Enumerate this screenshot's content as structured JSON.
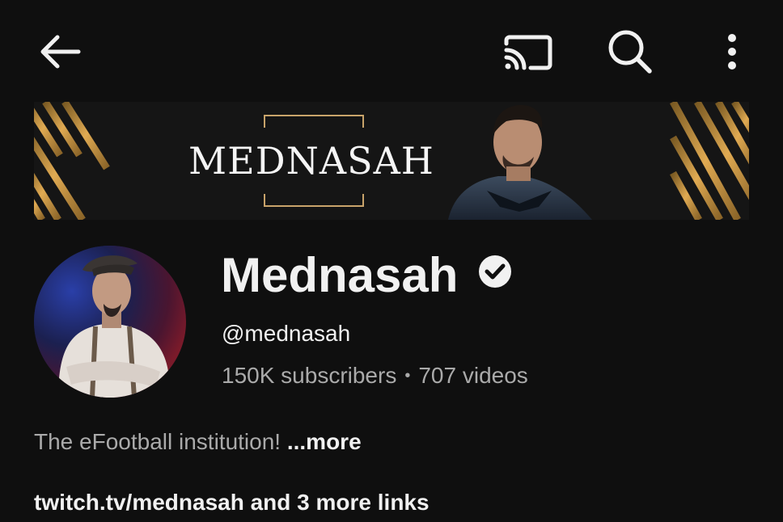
{
  "topbar": {
    "back_icon": "arrow-left-icon",
    "cast_icon": "cast-icon",
    "search_icon": "search-icon",
    "more_icon": "more-vertical-icon"
  },
  "banner": {
    "title": "MEDNASAH",
    "accent_color": "#d9a24a"
  },
  "channel": {
    "name": "Mednasah",
    "verified_icon": "verified-check-icon",
    "handle": "@mednasah",
    "subscribers": "150K subscribers",
    "separator": "•",
    "videos": "707 videos"
  },
  "description": {
    "text": "The eFootball institution!",
    "more_label": "...more"
  },
  "links": {
    "text": "twitch.tv/mednasah and 3 more links"
  }
}
